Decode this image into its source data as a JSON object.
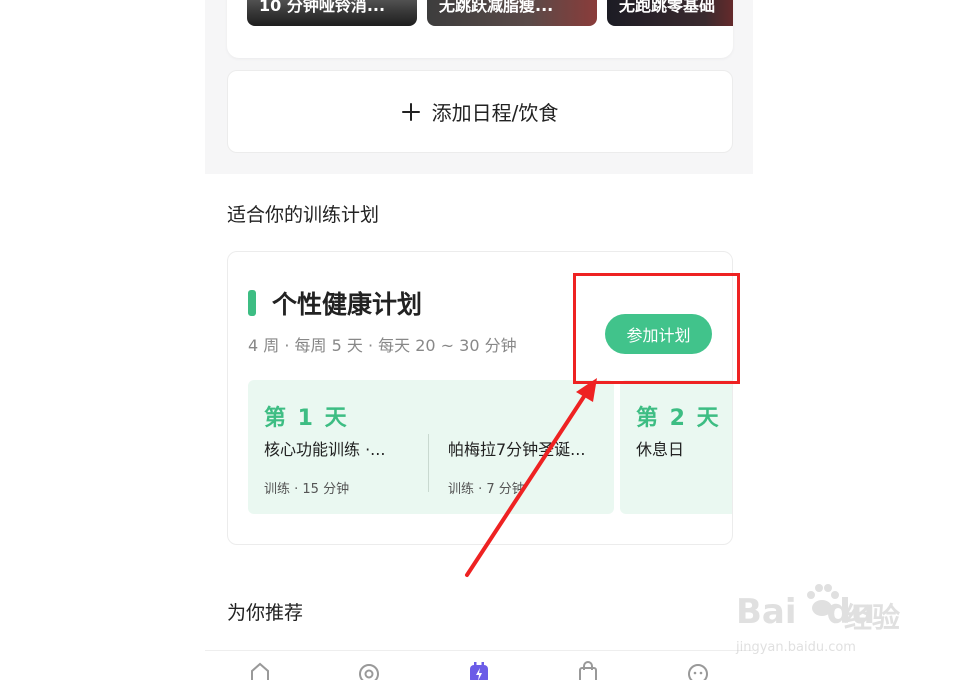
{
  "courses": [
    {
      "label": "10 分钟哑铃消..."
    },
    {
      "label": "无跳跃减脂瘦..."
    },
    {
      "label": "无跑跳零基础"
    }
  ],
  "add_schedule": {
    "label": "添加日程/饮食"
  },
  "sections": {
    "plans_title": "适合你的训练计划",
    "recommend_title": "为你推荐"
  },
  "plan": {
    "title": "个性健康计划",
    "meta": "4 周 · 每周 5 天 · 每天 20 ~ 30 分钟",
    "join_label": "参加计划",
    "days": [
      {
        "title": "第 1 天",
        "tasks": [
          {
            "name": "核心功能训练 ·...",
            "meta": "训练 · 15 分钟"
          },
          {
            "name": "帕梅拉7分钟圣诞...",
            "meta": "训练 · 7 分钟"
          }
        ]
      },
      {
        "title": "第 2 天",
        "rest": "休息日"
      }
    ]
  },
  "tabbar": {
    "items": [
      {
        "icon": "home-icon"
      },
      {
        "icon": "explore-icon"
      },
      {
        "icon": "plan-calendar-icon",
        "active": true
      },
      {
        "icon": "shop-bag-icon"
      },
      {
        "icon": "profile-icon"
      }
    ]
  },
  "watermark": {
    "brand": "Bai",
    "brand_suffix": "du",
    "cn": "经验",
    "url": "jingyan.baidu.com"
  },
  "colors": {
    "accent_green": "#3dbd83",
    "button_green": "#41c38b",
    "annotation_red": "#ee2222",
    "day_card_bg": "#eaf8f1"
  }
}
